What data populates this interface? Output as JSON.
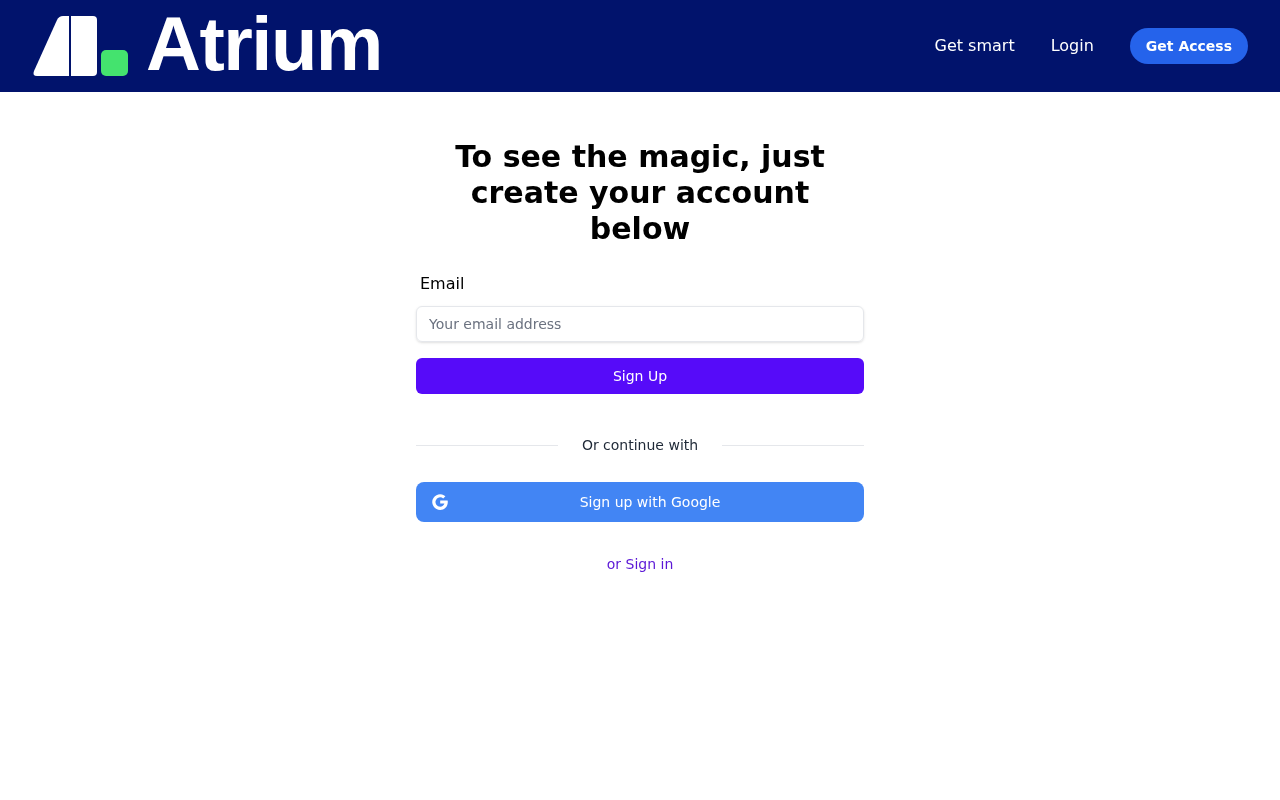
{
  "header": {
    "logo": {
      "text": "Atrium"
    },
    "nav_links": [
      "Get smart",
      "Login"
    ],
    "cta_button": "Get Access"
  },
  "signup_form": {
    "heading": "To see the magic, just create your account below",
    "email_field": {
      "label": "Email",
      "placeholder": "Your email address"
    },
    "submit_button": "Sign Up",
    "divider_text": "Or continue with",
    "google_button": "Sign up with Google",
    "sign_in_link": "or Sign in"
  }
}
